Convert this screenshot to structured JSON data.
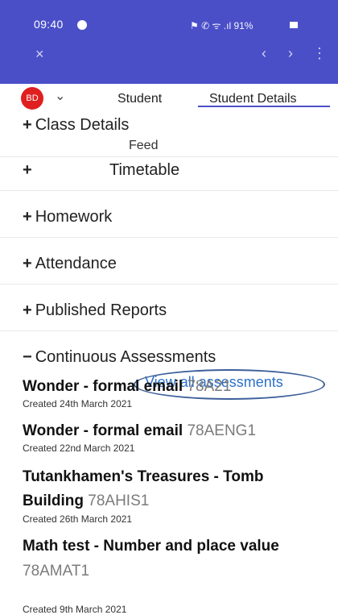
{
  "status_bar": {
    "time": "09:40",
    "icons": "⚑ ✆ ᯤ .ıl 91%"
  },
  "nav": {
    "close_icon": "×",
    "back_icon": "‹",
    "forward_icon": "›",
    "more_icon": "⋮"
  },
  "tabs": {
    "avatar_initials": "BD",
    "student_label": "Student",
    "details_label": "Student Details",
    "dropdown_icon": "⌄"
  },
  "sections": {
    "class_details": "Class Details",
    "feed": "Feed",
    "timetable": "Timetable",
    "homework": "Homework",
    "attendance": "Attendance",
    "published_reports": "Published Reports",
    "continuous_assessments": "Continuous Assessments",
    "plus_icon": "+",
    "minus_icon": "−"
  },
  "view_all_label": "View all assessments",
  "assessments": [
    {
      "title": "Wonder - formal email",
      "code": "78A21",
      "created": "Created 24th March 2021"
    },
    {
      "title": "Wonder - formal email",
      "code": "78AENG1",
      "created": "Created 22nd March 2021"
    },
    {
      "title": "Tutankhamen's Treasures - Tomb",
      "title2": "Building",
      "code": "78AHIS1",
      "created": "Created 26th March 2021"
    },
    {
      "title": "Math test - Number and place value",
      "code": "78AMAT1",
      "created": "Created 9th March 2021"
    }
  ],
  "colors": {
    "header": "#4a4fc8",
    "link": "#2d70c9",
    "avatar": "#e02020"
  }
}
